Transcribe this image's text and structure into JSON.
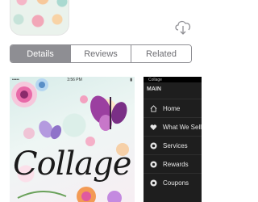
{
  "segmented": {
    "tabs": [
      {
        "label": "Details",
        "active": true
      },
      {
        "label": "Reviews",
        "active": false
      },
      {
        "label": "Related",
        "active": false
      }
    ]
  },
  "screenshot1": {
    "status_time": "3:56 PM",
    "title": "Collage"
  },
  "screenshot2": {
    "status_text": "Collage",
    "menu_header": "MAIN",
    "menu_items": [
      {
        "label": "Home",
        "icon": "home-icon"
      },
      {
        "label": "What We Sell",
        "icon": "heart-icon"
      },
      {
        "label": "Services",
        "icon": "services-icon"
      },
      {
        "label": "Rewards",
        "icon": "rewards-icon"
      },
      {
        "label": "Coupons",
        "icon": "coupons-icon"
      }
    ]
  },
  "colors": {
    "segment_active_bg": "#8e8e93",
    "menu_bg": "#1e1e1e",
    "download_icon": "#8e8e93"
  }
}
